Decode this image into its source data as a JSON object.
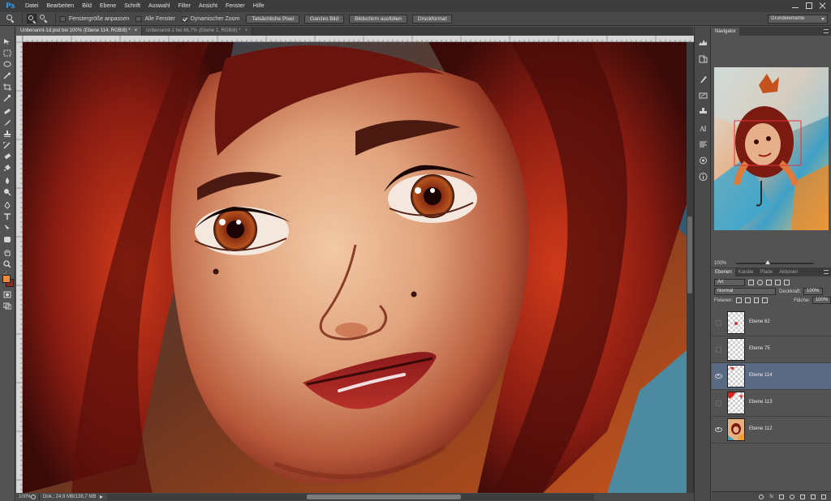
{
  "app": {
    "logo": "Ps"
  },
  "menu": [
    "Datei",
    "Bearbeiten",
    "Bild",
    "Ebene",
    "Schrift",
    "Auswahl",
    "Filter",
    "Ansicht",
    "Fenster",
    "Hilfe"
  ],
  "options": {
    "fit_window": "Fenstergröße anpassen",
    "all_windows": "Alle Fenster",
    "dynamic_zoom": "Dynamischer Zoom",
    "actual_pixels": "Tatsächliche Pixel",
    "fit_screen": "Ganzes Bild",
    "fill_screen": "Bildschirm ausfüllen",
    "print_size": "Druckformat",
    "workspace": "Grundelemente",
    "fit_window_checked": false,
    "all_windows_checked": false,
    "dynamic_zoom_checked": true
  },
  "tabs": [
    {
      "label": "Unbenannt-1d.psd bei 100% (Ebene 114, RGB/8) *",
      "active": true
    },
    {
      "label": "Unbenannt-1 bei 66,7% (Ebene 1, RGB/8) *",
      "active": false
    }
  ],
  "status": {
    "zoom": "100%",
    "doc_size": "Dok.: 24,9 MB/138,7 MB"
  },
  "colors": {
    "foreground": "#f08a3c",
    "background": "#8a2a1c",
    "selected_layer": "#5b6a84"
  },
  "navigator": {
    "title": "Navigator",
    "zoom": "100%"
  },
  "layers_panel": {
    "tabs": [
      "Ebenen",
      "Kanäle",
      "Pfade",
      "Aktionen"
    ],
    "filter_kind": "Art",
    "blend_mode": "Normal",
    "opacity_label": "Deckkraft:",
    "opacity": "100%",
    "lock_label": "Fixieren:",
    "fill_label": "Fläche:",
    "fill": "100%",
    "layers": [
      {
        "name": "Ebene 62",
        "visible": false,
        "selected": false
      },
      {
        "name": "Ebene 75",
        "visible": false,
        "selected": false
      },
      {
        "name": "Ebene 114",
        "visible": true,
        "selected": true
      },
      {
        "name": "Ebene 113",
        "visible": false,
        "selected": false
      },
      {
        "name": "Ebene 112",
        "visible": true,
        "selected": false
      }
    ]
  }
}
